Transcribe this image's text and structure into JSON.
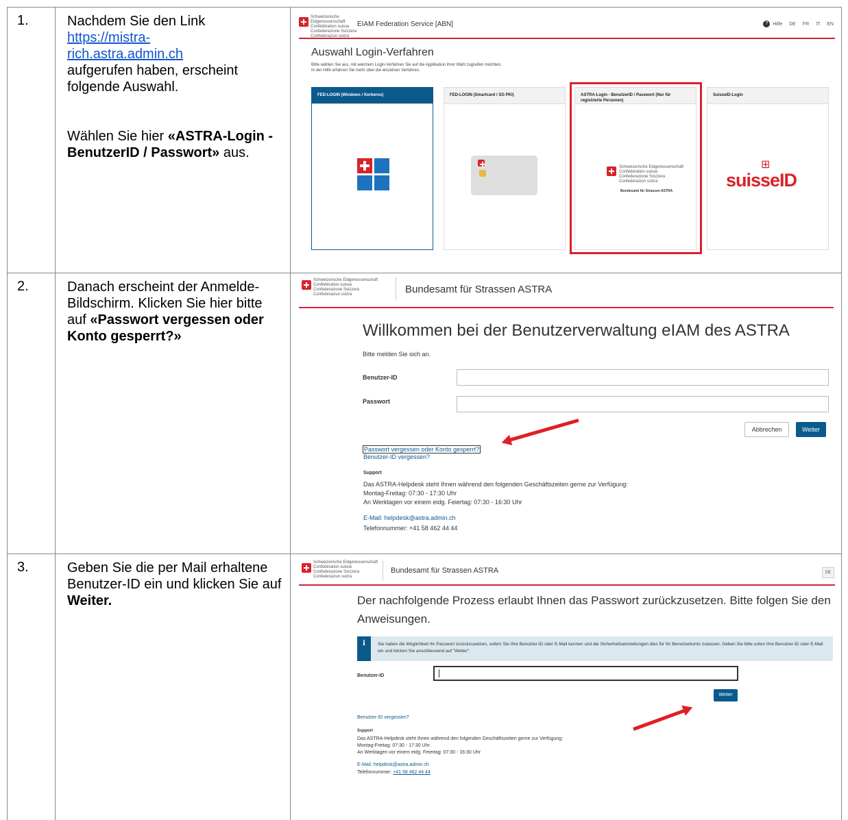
{
  "rows": [
    {
      "number": "1.",
      "text_before": "Nachdem Sie den Link ",
      "link": "https://mistra-rich.astra.admin.ch",
      "link_line1": "https://mistra-",
      "link_line2": "rich.astra.admin.ch",
      "text_after": " aufgerufen haben, erscheint folgende Auswahl.",
      "text2_before": "Wählen Sie hier ",
      "text2_bold": "«ASTRA-Login - BenutzerID / Passwort»",
      "text2_after": " aus.",
      "screenshot": {
        "federal_text": [
          "Schweizerische Eidgenossenschaft",
          "Confédération suisse",
          "Confederazione Svizzera",
          "Confederaziun svizra"
        ],
        "app_title": "EIAM Federation Service [ABN]",
        "help_icon": "help-circle-icon",
        "help_label": "Hilfe",
        "languages": [
          "DE",
          "FR",
          "IT",
          "EN"
        ],
        "heading": "Auswahl Login-Verfahren",
        "intro_line1": "Bitte wählen Sie aus, mit welchem Login-Verfahren Sie auf die Applikation ihrer Wahl zugreifen möchten.",
        "intro_line2": "In der Hilfe erfahren Sie mehr über die einzelnen Verfahren.",
        "cards": [
          {
            "title": "FED-LOGIN (Windows / Kerberos)",
            "icon": "windows-icon",
            "selected": true
          },
          {
            "title": "FED-LOGIN (Smartcard / SG PKI)",
            "icon": "smartcard-icon",
            "selected": false
          },
          {
            "title": "ASTRA-Login - BenutzerID / Passwort (Nur für registrierte Personen)",
            "icon": "federal-logo",
            "logo_sub": "Bundesamt für Strassen ASTRA",
            "selected": false,
            "highlighted": true
          },
          {
            "title": "SuisseID-Login",
            "icon": "suisseid-logo",
            "logo_text": "suisseID",
            "selected": false
          }
        ]
      }
    },
    {
      "number": "2.",
      "text_before": "Danach erscheint der Anmelde-Bildschirm. Klicken Sie hier bitte auf ",
      "text_bold": "«Passwort vergessen oder Konto gesperrt?»",
      "screenshot": {
        "federal_text": [
          "Schweizerische Eidgenossenschaft",
          "Confédération suisse",
          "Confederazione Svizzera",
          "Confederaziun svizra"
        ],
        "office": "Bundesamt für Strassen ASTRA",
        "welcome": "Willkommen bei der Benutzerverwaltung eIAM des ASTRA",
        "prompt": "Bitte melden Sie sich an.",
        "userid_label": "Benutzer-ID",
        "password_label": "Passwort",
        "cancel_label": "Abbrechen",
        "next_label": "Weiter",
        "forgot_password": "Passwort vergessen oder Konto gesperrt?",
        "forgot_userid": "Benutzer-ID vergessen?",
        "support_title": "Support",
        "support_line1": "Das ASTRA-Helpdesk steht Ihnen während den folgenden Geschäftszeiten gerne zur Verfügung:",
        "support_line2": "Montag-Freitag: 07:30 - 17:30 Uhr",
        "support_line3": "An Werktagen vor einem eidg. Feiertag: 07:30 - 16:30 Uhr",
        "email": "E-Mail: helpdesk@astra.admin.ch",
        "phone": "Telefonnummer: +41 58 462 44 44"
      }
    },
    {
      "number": "3.",
      "text_before": "Geben Sie die per Mail erhaltene Benutzer-ID ein und klicken Sie auf ",
      "text_bold": "Weiter.",
      "screenshot": {
        "federal_text": [
          "Schweizerische Eidgenossenschaft",
          "Confédération suisse",
          "Confederazione Svizzera",
          "Confederaziun svizra"
        ],
        "office": "Bundesamt für Strassen ASTRA",
        "lang": "DE",
        "heading": "Der nachfolgende Prozess erlaubt Ihnen das Passwort zurückzusetzen. Bitte folgen Sie den Anweisungen.",
        "info_icon": "i",
        "info_text": "Sie haben die Möglichkeit Ihr Passwort zurückzusetzen, sofern Sie Ihre Benutzer-ID oder E-Mail kennen und die Sicherheitseinstellungen dies für Ihr Benutzerkonto zulassen. Geben Sie bitte unten Ihre Benutzer-ID oder E-Mail ein und klicken Sie anschliessend auf \"Weiter\".",
        "userid_label": "Benutzer-ID",
        "next_label": "Weiter",
        "forgot_userid": "Benutzer-ID vergessen?",
        "support_title": "Support",
        "support_line1": "Das ASTRA-Helpdesk steht Ihnen während den folgenden Geschäftszeiten gerne zur Verfügung:",
        "support_line2": "Montag-Freitag: 07:30 - 17:30 Uhr",
        "support_line3": "An Werktagen vor einem eidg. Feiertag: 07:30 - 16:30 Uhr",
        "email": "E-Mail: helpdesk@astra.admin.ch",
        "phone_label": "Telefonnummer: ",
        "phone_number": "+41 58 462 44 44"
      }
    }
  ],
  "colors": {
    "accent_red": "#e01f26",
    "federal_blue": "#0b5a8c",
    "link_blue": "#1155cc"
  }
}
